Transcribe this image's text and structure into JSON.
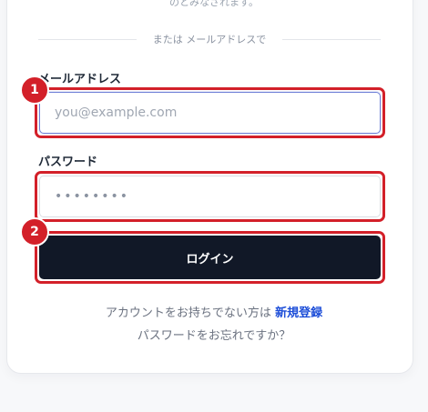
{
  "top_note": "のとみなされます。",
  "divider": {
    "label": "または メールアドレスで"
  },
  "email": {
    "label": "メールアドレス",
    "placeholder": "you@example.com",
    "value": ""
  },
  "password": {
    "label": "パスワード",
    "masked_value": "••••••••"
  },
  "login": {
    "label": "ログイン"
  },
  "annotations": {
    "badge_1": "1",
    "badge_2": "2",
    "highlight_color": "#d32029"
  },
  "signup": {
    "prompt": "アカウントをお持ちでない方は",
    "link_label": "新規登録"
  },
  "forgot": {
    "label": "パスワードをお忘れですか？"
  },
  "colors": {
    "primary_button": "#111827",
    "link": "#1d4ed8",
    "focus_border": "#6e7fd6"
  }
}
